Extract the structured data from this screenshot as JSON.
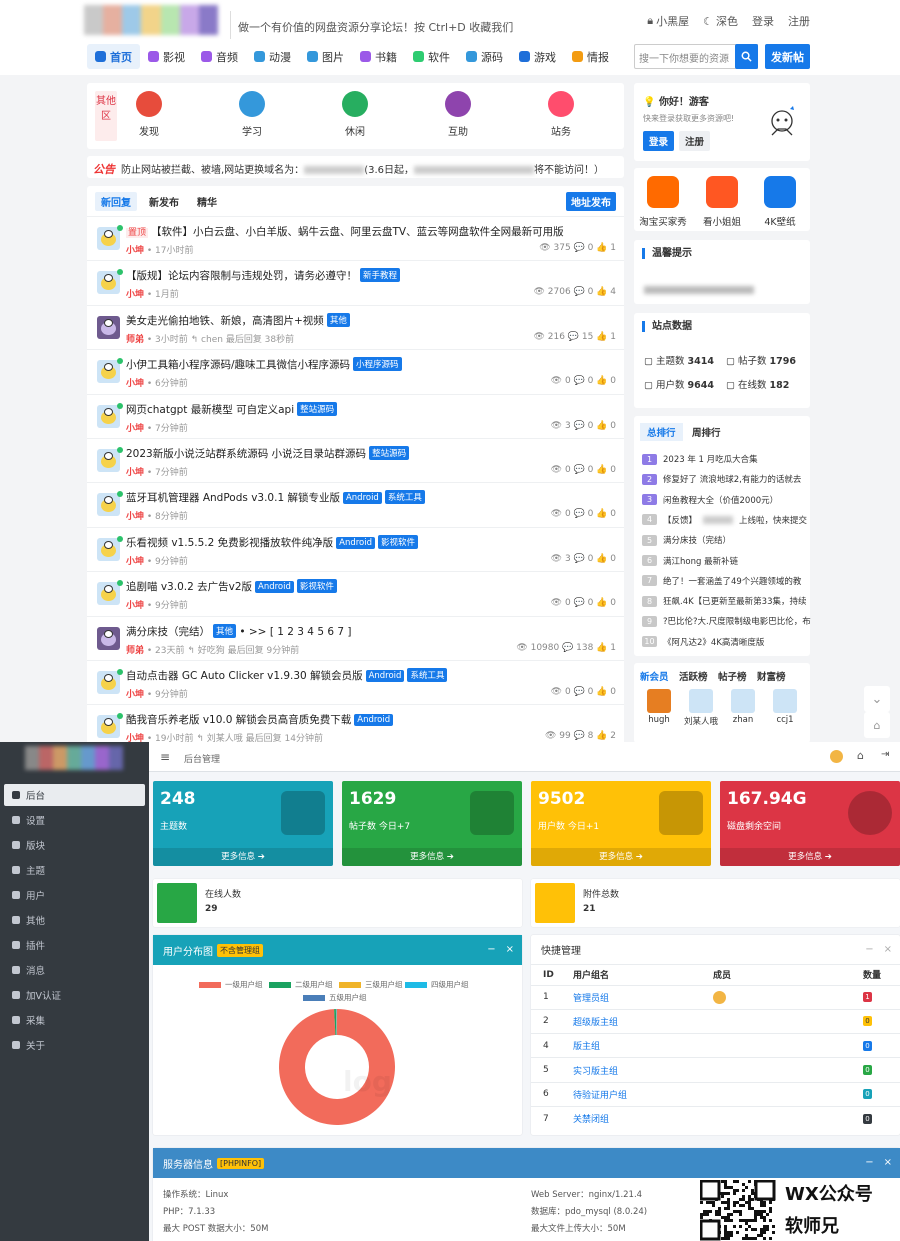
{
  "forum": {
    "slogan": "做一个有价值的网盘资源分享论坛！按 Ctrl+D 收藏我们",
    "topright": [
      "小黑屋",
      "深色",
      "登录",
      "注册"
    ],
    "nav": [
      {
        "label": "首页",
        "color": "#1e6fd9"
      },
      {
        "label": "影视",
        "color": "#9b59e8"
      },
      {
        "label": "音频",
        "color": "#9b59e8"
      },
      {
        "label": "动漫",
        "color": "#3498db"
      },
      {
        "label": "图片",
        "color": "#3498db"
      },
      {
        "label": "书籍",
        "color": "#9b59e8"
      },
      {
        "label": "软件",
        "color": "#2ecc71"
      },
      {
        "label": "源码",
        "color": "#3498db"
      },
      {
        "label": "游戏",
        "color": "#1e6fd9"
      },
      {
        "label": "情报",
        "color": "#f39c12"
      }
    ],
    "search_placeholder": "搜一下你想要的资源",
    "post_button": "发新帖",
    "quick": {
      "tag": "其他区",
      "items": [
        {
          "label": "发现",
          "color": "#e74c3c"
        },
        {
          "label": "学习",
          "color": "#3498db"
        },
        {
          "label": "休闲",
          "color": "#27ae60"
        },
        {
          "label": "互助",
          "color": "#8e44ad"
        },
        {
          "label": "站务",
          "color": "#ff4d6d"
        }
      ]
    },
    "announce": {
      "tag": "公告",
      "text_a": "防止网站被拦截、被墙,网站更换域名为：",
      "text_b": "(3.6日起，",
      "text_c": "将不能访问！）"
    },
    "tabs": [
      "新回复",
      "新发布",
      "精华"
    ],
    "addr_button": "地址发布",
    "threads": [
      {
        "pin": "置顶",
        "title": "【软件】小白云盘、小白羊版、蜗牛云盘、阿里云盘TV、蓝云等网盘软件全网最新可用版",
        "badges": [],
        "author": "小坤",
        "time": "17小时前",
        "reply": "",
        "stats": "👁 375  💬 0  👍 1",
        "avatar": "duck"
      },
      {
        "pin": "",
        "title": "【版规】论坛内容限制与违规处罚，请务必遵守！",
        "badges": [
          "新手教程"
        ],
        "author": "小坤",
        "time": "1月前",
        "reply": "",
        "stats": "👁 2706  💬 0  👍 4",
        "avatar": "duck"
      },
      {
        "pin": "",
        "title": "美女走光偷拍地铁、新娘，高清图片+视频",
        "badges": [
          "其他"
        ],
        "author": "师弟",
        "time": "3小时前",
        "reply": "↰ chen 最后回复 38秒前",
        "stats": "👁 216  💬 15  👍 1",
        "avatar": "girl"
      },
      {
        "pin": "",
        "title": "小伊工具箱小程序源码/趣味工具微信小程序源码",
        "badges": [
          "小程序源码"
        ],
        "author": "小坤",
        "time": "6分钟前",
        "reply": "",
        "stats": "👁 0  💬 0  👍 0",
        "avatar": "duck"
      },
      {
        "pin": "",
        "title": "网页chatgpt 最新模型 可自定义api",
        "badges": [
          "整站源码"
        ],
        "author": "小坤",
        "time": "7分钟前",
        "reply": "",
        "stats": "👁 3  💬 0  👍 0",
        "avatar": "duck"
      },
      {
        "pin": "",
        "title": "2023新版小说泛站群系统源码 小说泛目录站群源码",
        "badges": [
          "整站源码"
        ],
        "author": "小坤",
        "time": "7分钟前",
        "reply": "",
        "stats": "👁 0  💬 0  👍 0",
        "avatar": "duck"
      },
      {
        "pin": "",
        "title": "蓝牙耳机管理器 AndPods v3.0.1 解锁专业版",
        "badges": [
          "Android",
          "系统工具"
        ],
        "author": "小坤",
        "time": "8分钟前",
        "reply": "",
        "stats": "👁 0  💬 0  👍 0",
        "avatar": "duck"
      },
      {
        "pin": "",
        "title": "乐看视频 v1.5.5.2 免费影视播放软件纯净版",
        "badges": [
          "Android",
          "影视软件"
        ],
        "author": "小坤",
        "time": "9分钟前",
        "reply": "",
        "stats": "👁 3  💬 0  👍 0",
        "avatar": "duck"
      },
      {
        "pin": "",
        "title": "追剧喵 v3.0.2 去广告v2版",
        "badges": [
          "Android",
          "影视软件"
        ],
        "author": "小坤",
        "time": "9分钟前",
        "reply": "",
        "stats": "👁 0  💬 0  👍 0",
        "avatar": "duck"
      },
      {
        "pin": "",
        "title": "满分床技（完结）",
        "badges": [
          "其他"
        ],
        "extra": " • >> [ 1 2 3 4 5 6 7 ]",
        "author": "师弟",
        "time": "23天前",
        "reply": "↰ 好吃狗 最后回复 9分钟前",
        "stats": "👁 10980  💬 138  👍 1",
        "avatar": "girl"
      },
      {
        "pin": "",
        "title": "自动点击器 GC Auto Clicker v1.9.30 解锁会员版",
        "badges": [
          "Android",
          "系统工具"
        ],
        "author": "小坤",
        "time": "9分钟前",
        "reply": "",
        "stats": "👁 0  💬 0  👍 0",
        "avatar": "duck"
      },
      {
        "pin": "",
        "title": "酷我音乐养老版 v10.0 解锁会员高音质免费下载",
        "badges": [
          "Android"
        ],
        "author": "小坤",
        "time": "19小时前",
        "reply": "↰ 刘某人哦 最后回复 14分钟前",
        "stats": "👁 99  💬 8  👍 2",
        "avatar": "duck"
      }
    ],
    "sidebar": {
      "hello": "你好！游客",
      "hello_sub": "快来登录获取更多资源吧!",
      "login": "登录",
      "register": "注册",
      "apps": [
        {
          "label": "淘宝买家秀",
          "color": "#ff6a00"
        },
        {
          "label": "看小姐姐",
          "color": "#ff5722"
        },
        {
          "label": "4K壁纸",
          "color": "#1679e9"
        }
      ],
      "tips_title": "温馨提示",
      "stats_title": "站点数据",
      "stats": [
        {
          "label": "主题数",
          "value": "3414"
        },
        {
          "label": "帖子数",
          "value": "1796"
        },
        {
          "label": "用户数",
          "value": "9644"
        },
        {
          "label": "在线数",
          "value": "182"
        }
      ],
      "rank_tabs": [
        "总排行",
        "周排行"
      ],
      "ranks": [
        {
          "n": "1",
          "t": "2023 年 1 月吃瓜大合集"
        },
        {
          "n": "2",
          "t": "修复好了 流浪地球2,有能力的话就去"
        },
        {
          "n": "3",
          "t": "闲鱼教程大全（价值2000元）"
        },
        {
          "n": "4",
          "t": "【反馈】",
          "t2": "上线啦，快来提交"
        },
        {
          "n": "5",
          "t": "满分床技（完结）"
        },
        {
          "n": "6",
          "t": "满江hong 最新补链"
        },
        {
          "n": "7",
          "t": "绝了！一套涵盖了49个兴趣领域的教"
        },
        {
          "n": "8",
          "t": "狂飙.4K【已更新至最新第33集，持续"
        },
        {
          "n": "9",
          "t": "?巴比伦?大.尺度限制级电影巴比伦，布"
        },
        {
          "n": "10",
          "t": "《阿凡达2》4K高清晰度版"
        }
      ],
      "member_tabs": [
        "新会员",
        "活跃榜",
        "帖子榜",
        "财富榜"
      ],
      "members": [
        "hugh",
        "刘某人哦",
        "zhan",
        "ccj1"
      ]
    }
  },
  "admin": {
    "topbar_title": "后台管理",
    "menu": [
      "后台",
      "设置",
      "版块",
      "主题",
      "用户",
      "其他",
      "插件",
      "消息",
      "加V认证",
      "采集",
      "关于"
    ],
    "boxes": [
      {
        "num": "248",
        "label": "主题数",
        "more": "更多信息 ➔",
        "color": "#17a2b8"
      },
      {
        "num": "1629",
        "label": "帖子数 今日+7",
        "more": "更多信息 ➔",
        "color": "#28a745"
      },
      {
        "num": "9502",
        "label": "用户数 今日+1",
        "more": "更多信息 ➔",
        "color": "#ffc107"
      },
      {
        "num": "167.94G",
        "label": "磁盘剩余空间",
        "more": "更多信息 ➔",
        "color": "#dc3545"
      }
    ],
    "info": [
      {
        "title": "在线人数",
        "value": "29",
        "color": "#28a745"
      },
      {
        "title": "附件总数",
        "value": "21",
        "color": "#ffc107"
      }
    ],
    "user_dist": {
      "title": "用户分布图",
      "tag": "不含管理组",
      "legend": [
        {
          "name": "一级用户组",
          "color": "#f26b5b"
        },
        {
          "name": "二级用户组",
          "color": "#1aa260"
        },
        {
          "name": "三级用户组",
          "color": "#f0b429"
        },
        {
          "name": "四级用户组",
          "color": "#1ebbe6"
        },
        {
          "name": "五级用户组",
          "color": "#4a7eb8"
        }
      ]
    },
    "chart_data": {
      "type": "pie",
      "categories": [
        "一级用户组",
        "二级用户组",
        "三级用户组",
        "四级用户组",
        "五级用户组"
      ],
      "values": [
        99.2,
        0.5,
        0.1,
        0.1,
        0.1
      ],
      "title": "用户分布图"
    },
    "quick": {
      "title": "快捷管理",
      "headers": [
        "ID",
        "用户组名",
        "成员",
        "数量"
      ],
      "rows": [
        {
          "id": "1",
          "name": "管理员组",
          "count": "1",
          "color": "#dc3545",
          "avatar": true
        },
        {
          "id": "2",
          "name": "超级版主组",
          "count": "0",
          "color": "#ffc107",
          "avatar": false
        },
        {
          "id": "4",
          "name": "版主组",
          "count": "0",
          "color": "#1679e9",
          "avatar": false
        },
        {
          "id": "5",
          "name": "实习版主组",
          "count": "0",
          "color": "#28a745",
          "avatar": false
        },
        {
          "id": "6",
          "name": "待验证用户组",
          "count": "0",
          "color": "#17a2b8",
          "avatar": false
        },
        {
          "id": "7",
          "name": "关禁闭组",
          "count": "0",
          "color": "#343a40",
          "avatar": false
        }
      ]
    },
    "server": {
      "title": "服务器信息",
      "tag": "[PHPINFO]",
      "left": [
        "操作系统：Linux",
        "PHP：7.1.33",
        "最大 POST 数据大小：50M"
      ],
      "right": [
        "Web Server：nginx/1.21.4",
        "数据库：pdo_mysql (8.0.24)",
        "最大文件上传大小：50M"
      ]
    },
    "watermark": [
      "WX公众号",
      "软师兄"
    ]
  }
}
